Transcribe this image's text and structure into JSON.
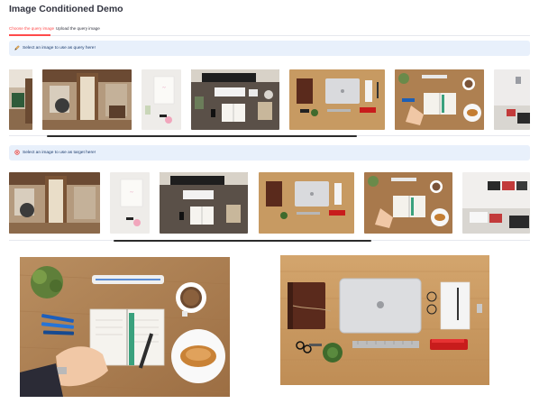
{
  "app": {
    "title": "Image Conditioned Demo"
  },
  "tabs": [
    {
      "label": "Choose the query image",
      "active": true
    },
    {
      "label": "Upload the query image",
      "active": false
    }
  ],
  "alerts": {
    "query": {
      "icon": "pencil-icon",
      "text": "Select an image to use as query here!"
    },
    "target": {
      "icon": "target-icon",
      "text": "Select an image to use as target here!"
    }
  },
  "colors": {
    "accent": "#ff4b4b",
    "alert_bg": "#e8f0fb",
    "alert_text": "#1a3a6b"
  }
}
